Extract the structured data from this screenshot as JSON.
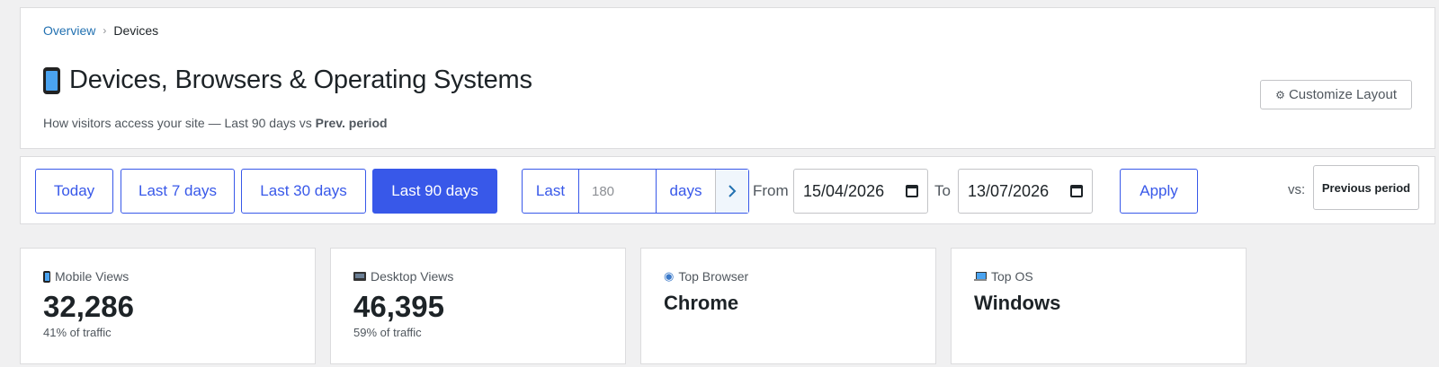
{
  "breadcrumb": {
    "parent": "Overview",
    "separator": "›",
    "current": "Devices"
  },
  "header": {
    "title": "Devices, Browsers & Operating Systems",
    "subtitle_prefix": "How visitors access your site — Last 90 days vs ",
    "subtitle_bold": "Prev. period",
    "customize_icon": "⚙",
    "customize_label": "Customize Layout"
  },
  "filters": {
    "ranges": [
      "Today",
      "Last 7 days",
      "Last 30 days",
      "Last 90 days"
    ],
    "active_range": "Last 90 days",
    "custom": {
      "prefix": "Last",
      "placeholder": "180",
      "suffix": "days"
    },
    "from_label": "From",
    "from_value": "15/04/2026",
    "to_label": "To",
    "to_value": "13/07/2026",
    "apply_label": "Apply",
    "vs_label": "vs:",
    "compare_value": "Previous period"
  },
  "stats": [
    {
      "icon": "mobile-phone-icon",
      "label": "Mobile Views",
      "value": "32,286",
      "sub": "41% of traffic"
    },
    {
      "icon": "desktop-icon",
      "label": "Desktop Views",
      "value": "46,395",
      "sub": "59% of traffic"
    },
    {
      "icon": "globe-icon",
      "label": "Top Browser",
      "value": "Chrome",
      "sub": ""
    },
    {
      "icon": "laptop-icon",
      "label": "Top OS",
      "value": "Windows",
      "sub": ""
    }
  ],
  "colors": {
    "accent": "#3858e9",
    "link": "#2271b1",
    "background": "#f0f0f1"
  }
}
